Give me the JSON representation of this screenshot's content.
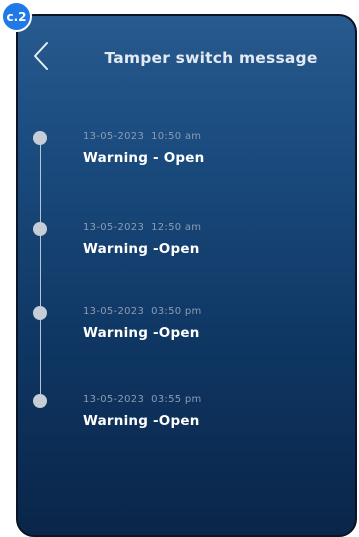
{
  "badge": {
    "label": "c.2"
  },
  "header": {
    "back_icon": "chevron-left-icon",
    "title": "Tamper switch message"
  },
  "events": [
    {
      "timestamp": "13-05-2023  10:50 am",
      "status": "Warning - Open"
    },
    {
      "timestamp": "13-05-2023  12:50 am",
      "status": "Warning -Open"
    },
    {
      "timestamp": "13-05-2023  03:50 pm",
      "status": "Warning -Open"
    },
    {
      "timestamp": "13-05-2023  03:55 pm",
      "status": "Warning -Open"
    }
  ],
  "colors": {
    "background_top": "#275a8e",
    "background_bottom": "#0a2549",
    "badge": "#1f79e6",
    "timeline_dot": "#c6cdd6",
    "timestamp_text": "#8c9cb2",
    "status_text": "#ffffff"
  }
}
